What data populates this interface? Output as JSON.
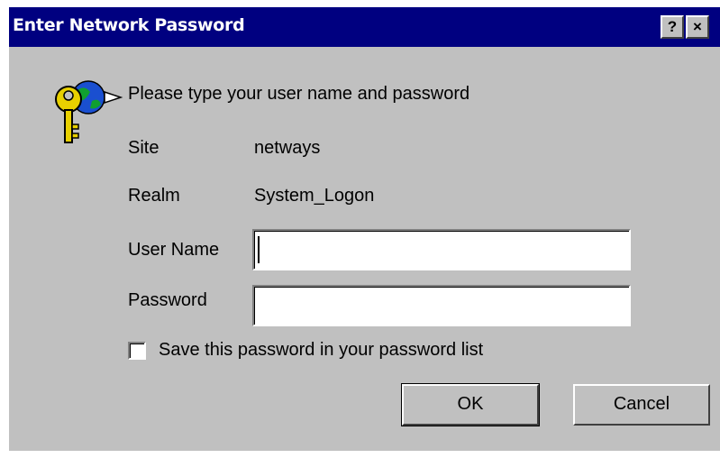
{
  "dialog": {
    "title": "Enter Network Password",
    "help_button": "?",
    "close_button": "×",
    "prompt": "Please type your user name and password",
    "site_label": "Site",
    "site_value": "netways",
    "realm_label": "Realm",
    "realm_value": "System_Logon",
    "username_label": "User Name",
    "username_value": "",
    "password_label": "Password",
    "password_value": "",
    "save_password_label": "Save this password in your password list",
    "save_password_checked": false,
    "ok_button": "OK",
    "cancel_button": "Cancel"
  },
  "icons": {
    "key": "key-icon",
    "globe": "globe-icon"
  },
  "colors": {
    "titlebar": "#000080",
    "dialog_face": "#c0c0c0"
  }
}
